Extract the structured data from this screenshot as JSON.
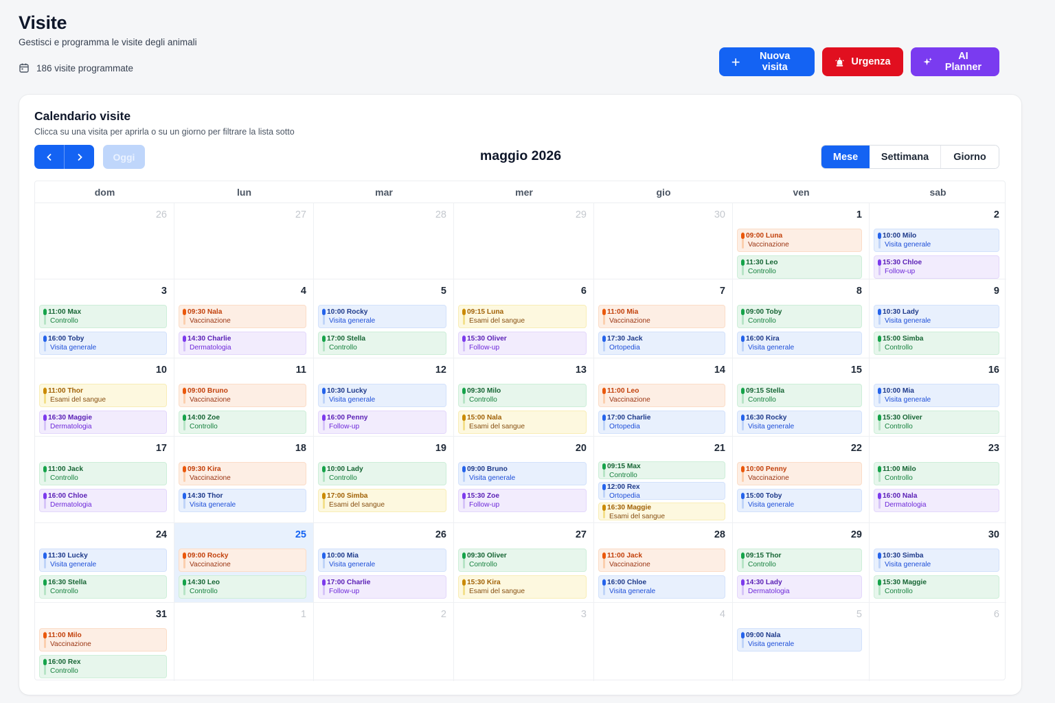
{
  "header": {
    "title": "Visite",
    "subtitle": "Gestisci e programma le visite degli animali",
    "visit_count": "186 visite programmate",
    "visit_count_icon": "calendar-icon"
  },
  "actions": {
    "new_visit": "Nuova visita",
    "urgent": "Urgenza",
    "ai_planner": "AI Planner"
  },
  "calendar": {
    "title": "Calendario visite",
    "subtitle": "Clicca su una visita per aprirla o su un giorno per filtrare la lista sotto",
    "today_label": "Oggi",
    "month_label": "maggio 2026",
    "views": [
      "Mese",
      "Settimana",
      "Giorno"
    ],
    "active_view": "Mese",
    "weekdays": [
      "dom",
      "lun",
      "mar",
      "mer",
      "gio",
      "ven",
      "sab"
    ],
    "colors": {
      "orange": "#ea580c",
      "green": "#16a34a",
      "blue": "#2563eb",
      "purple": "#7c3aed",
      "yellow": "#ca8a04",
      "primary": "#1463f3"
    },
    "weeks": [
      [
        {
          "day": "26",
          "outside": true,
          "events": []
        },
        {
          "day": "27",
          "outside": true,
          "events": []
        },
        {
          "day": "28",
          "outside": true,
          "events": []
        },
        {
          "day": "29",
          "outside": true,
          "events": []
        },
        {
          "day": "30",
          "outside": true,
          "events": []
        },
        {
          "day": "1",
          "events": [
            {
              "time": "09:00 Luna",
              "type": "Vaccinazione",
              "color": "orange"
            },
            {
              "time": "11:30 Leo",
              "type": "Controllo",
              "color": "green"
            }
          ]
        },
        {
          "day": "2",
          "events": [
            {
              "time": "10:00 Milo",
              "type": "Visita generale",
              "color": "blue"
            },
            {
              "time": "15:30 Chloe",
              "type": "Follow-up",
              "color": "purple"
            }
          ]
        }
      ],
      [
        {
          "day": "3",
          "events": [
            {
              "time": "11:00 Max",
              "type": "Controllo",
              "color": "green"
            },
            {
              "time": "16:00 Toby",
              "type": "Visita generale",
              "color": "blue"
            }
          ]
        },
        {
          "day": "4",
          "events": [
            {
              "time": "09:30 Nala",
              "type": "Vaccinazione",
              "color": "orange"
            },
            {
              "time": "14:30 Charlie",
              "type": "Dermatologia",
              "color": "purple"
            }
          ]
        },
        {
          "day": "5",
          "events": [
            {
              "time": "10:00 Rocky",
              "type": "Visita generale",
              "color": "blue"
            },
            {
              "time": "17:00 Stella",
              "type": "Controllo",
              "color": "green"
            }
          ]
        },
        {
          "day": "6",
          "events": [
            {
              "time": "09:15 Luna",
              "type": "Esami del sangue",
              "color": "yellow"
            },
            {
              "time": "15:30 Oliver",
              "type": "Follow-up",
              "color": "purple"
            }
          ]
        },
        {
          "day": "7",
          "events": [
            {
              "time": "11:00 Mia",
              "type": "Vaccinazione",
              "color": "orange"
            },
            {
              "time": "17:30 Jack",
              "type": "Ortopedia",
              "color": "blue"
            }
          ]
        },
        {
          "day": "8",
          "events": [
            {
              "time": "09:00 Toby",
              "type": "Controllo",
              "color": "green"
            },
            {
              "time": "16:00 Kira",
              "type": "Visita generale",
              "color": "blue"
            }
          ]
        },
        {
          "day": "9",
          "events": [
            {
              "time": "10:30 Lady",
              "type": "Visita generale",
              "color": "blue"
            },
            {
              "time": "15:00 Simba",
              "type": "Controllo",
              "color": "green"
            }
          ]
        }
      ],
      [
        {
          "day": "10",
          "events": [
            {
              "time": "11:00 Thor",
              "type": "Esami del sangue",
              "color": "yellow"
            },
            {
              "time": "16:30 Maggie",
              "type": "Dermatologia",
              "color": "purple"
            }
          ]
        },
        {
          "day": "11",
          "events": [
            {
              "time": "09:00 Bruno",
              "type": "Vaccinazione",
              "color": "orange"
            },
            {
              "time": "14:00 Zoe",
              "type": "Controllo",
              "color": "green"
            }
          ]
        },
        {
          "day": "12",
          "events": [
            {
              "time": "10:30 Lucky",
              "type": "Visita generale",
              "color": "blue"
            },
            {
              "time": "16:00 Penny",
              "type": "Follow-up",
              "color": "purple"
            }
          ]
        },
        {
          "day": "13",
          "events": [
            {
              "time": "09:30 Milo",
              "type": "Controllo",
              "color": "green"
            },
            {
              "time": "15:00 Nala",
              "type": "Esami del sangue",
              "color": "yellow"
            }
          ]
        },
        {
          "day": "14",
          "events": [
            {
              "time": "11:00 Leo",
              "type": "Vaccinazione",
              "color": "orange"
            },
            {
              "time": "17:00 Charlie",
              "type": "Ortopedia",
              "color": "blue"
            }
          ]
        },
        {
          "day": "15",
          "events": [
            {
              "time": "09:15 Stella",
              "type": "Controllo",
              "color": "green"
            },
            {
              "time": "16:30 Rocky",
              "type": "Visita generale",
              "color": "blue"
            }
          ]
        },
        {
          "day": "16",
          "events": [
            {
              "time": "10:00 Mia",
              "type": "Visita generale",
              "color": "blue"
            },
            {
              "time": "15:30 Oliver",
              "type": "Controllo",
              "color": "green"
            }
          ]
        }
      ],
      [
        {
          "day": "17",
          "events": [
            {
              "time": "11:00 Jack",
              "type": "Controllo",
              "color": "green"
            },
            {
              "time": "16:00 Chloe",
              "type": "Dermatologia",
              "color": "purple"
            }
          ]
        },
        {
          "day": "18",
          "events": [
            {
              "time": "09:30 Kira",
              "type": "Vaccinazione",
              "color": "orange"
            },
            {
              "time": "14:30 Thor",
              "type": "Visita generale",
              "color": "blue"
            }
          ]
        },
        {
          "day": "19",
          "events": [
            {
              "time": "10:00 Lady",
              "type": "Controllo",
              "color": "green"
            },
            {
              "time": "17:00 Simba",
              "type": "Esami del sangue",
              "color": "yellow"
            }
          ]
        },
        {
          "day": "20",
          "events": [
            {
              "time": "09:00 Bruno",
              "type": "Visita generale",
              "color": "blue"
            },
            {
              "time": "15:30 Zoe",
              "type": "Follow-up",
              "color": "purple"
            }
          ]
        },
        {
          "day": "21",
          "events": [
            {
              "time": "09:15 Max",
              "type": "Controllo",
              "color": "green"
            },
            {
              "time": "12:00 Rex",
              "type": "Ortopedia",
              "color": "blue"
            },
            {
              "time": "16:30 Maggie",
              "type": "Esami del sangue",
              "color": "yellow"
            }
          ]
        },
        {
          "day": "22",
          "events": [
            {
              "time": "10:00 Penny",
              "type": "Vaccinazione",
              "color": "orange"
            },
            {
              "time": "15:00 Toby",
              "type": "Visita generale",
              "color": "blue"
            }
          ]
        },
        {
          "day": "23",
          "events": [
            {
              "time": "11:00 Milo",
              "type": "Controllo",
              "color": "green"
            },
            {
              "time": "16:00 Nala",
              "type": "Dermatologia",
              "color": "purple"
            }
          ]
        }
      ],
      [
        {
          "day": "24",
          "events": [
            {
              "time": "11:30 Lucky",
              "type": "Visita generale",
              "color": "blue"
            },
            {
              "time": "16:30 Stella",
              "type": "Controllo",
              "color": "green"
            }
          ]
        },
        {
          "day": "25",
          "today": true,
          "events": [
            {
              "time": "09:00 Rocky",
              "type": "Vaccinazione",
              "color": "orange"
            },
            {
              "time": "14:30 Leo",
              "type": "Controllo",
              "color": "green"
            }
          ]
        },
        {
          "day": "26",
          "events": [
            {
              "time": "10:00 Mia",
              "type": "Visita generale",
              "color": "blue"
            },
            {
              "time": "17:00 Charlie",
              "type": "Follow-up",
              "color": "purple"
            }
          ]
        },
        {
          "day": "27",
          "events": [
            {
              "time": "09:30 Oliver",
              "type": "Controllo",
              "color": "green"
            },
            {
              "time": "15:30 Kira",
              "type": "Esami del sangue",
              "color": "yellow"
            }
          ]
        },
        {
          "day": "28",
          "events": [
            {
              "time": "11:00 Jack",
              "type": "Vaccinazione",
              "color": "orange"
            },
            {
              "time": "16:00 Chloe",
              "type": "Visita generale",
              "color": "blue"
            }
          ]
        },
        {
          "day": "29",
          "events": [
            {
              "time": "09:15 Thor",
              "type": "Controllo",
              "color": "green"
            },
            {
              "time": "14:30 Lady",
              "type": "Dermatologia",
              "color": "purple"
            }
          ]
        },
        {
          "day": "30",
          "events": [
            {
              "time": "10:30 Simba",
              "type": "Visita generale",
              "color": "blue"
            },
            {
              "time": "15:30 Maggie",
              "type": "Controllo",
              "color": "green"
            }
          ]
        }
      ],
      [
        {
          "day": "31",
          "events": [
            {
              "time": "11:00 Milo",
              "type": "Vaccinazione",
              "color": "orange"
            },
            {
              "time": "16:00 Rex",
              "type": "Controllo",
              "color": "green"
            }
          ]
        },
        {
          "day": "1",
          "outside": true,
          "events": []
        },
        {
          "day": "2",
          "outside": true,
          "events": []
        },
        {
          "day": "3",
          "outside": true,
          "events": []
        },
        {
          "day": "4",
          "outside": true,
          "events": []
        },
        {
          "day": "5",
          "outside": true,
          "events": [
            {
              "time": "09:00 Nala",
              "type": "Visita generale",
              "color": "blue"
            }
          ]
        },
        {
          "day": "6",
          "outside": true,
          "events": []
        }
      ]
    ]
  }
}
